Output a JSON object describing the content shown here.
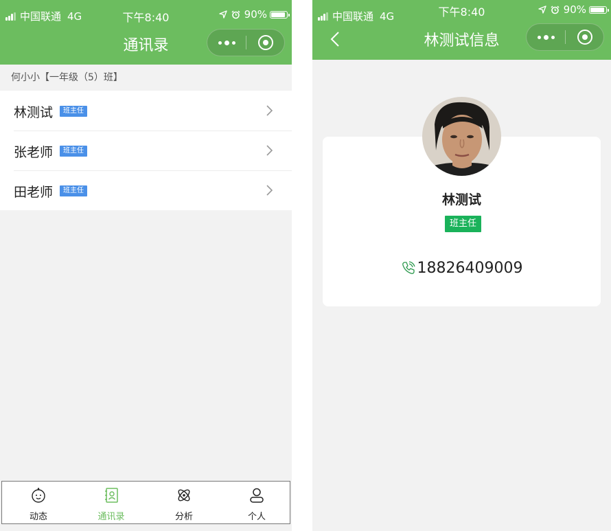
{
  "colors": {
    "header_green": "#6cbd5f",
    "badge_blue": "#4a90e8",
    "badge_green": "#1ab25a",
    "active_tab": "#6cbd5f",
    "background": "#f2f2f2"
  },
  "left_screen": {
    "status_bar": {
      "carrier": "中国联通",
      "network": "4G",
      "time": "下午8:40",
      "battery": "90%",
      "battery_level": 0.9,
      "icons": [
        "signal-icon",
        "location-icon",
        "alarm-icon",
        "battery-icon"
      ]
    },
    "nav": {
      "title": "通讯录",
      "icons": [
        "more-dots-icon",
        "close-circle-icon"
      ]
    },
    "class_label": "何小小【一年级（5）班】",
    "contacts": [
      {
        "name": "林测试",
        "role": "班主任",
        "icon": "chevron-right-icon"
      },
      {
        "name": "张老师",
        "role": "班主任",
        "icon": "chevron-right-icon"
      },
      {
        "name": "田老师",
        "role": "班主任",
        "icon": "chevron-right-icon"
      }
    ],
    "tabbar": {
      "tabs": [
        {
          "label": "动态",
          "icon": "baby-face-icon",
          "active": false
        },
        {
          "label": "通讯录",
          "icon": "contacts-book-icon",
          "active": true
        },
        {
          "label": "分析",
          "icon": "atom-icon",
          "active": false
        },
        {
          "label": "个人",
          "icon": "person-icon",
          "active": false
        }
      ]
    }
  },
  "right_screen": {
    "status_bar": {
      "carrier": "中国联通",
      "network": "4G",
      "time": "下午8:40",
      "battery": "90%",
      "battery_level": 0.9,
      "icons": [
        "signal-icon",
        "location-icon",
        "alarm-icon",
        "battery-icon"
      ]
    },
    "nav": {
      "title": "林测试信息",
      "icons": [
        "back-arrow-icon",
        "more-dots-icon",
        "close-circle-icon"
      ]
    },
    "profile": {
      "avatar": "avatar-photo",
      "name": "林测试",
      "role": "班主任",
      "phone": "18826409009",
      "phone_icon": "phone-icon"
    }
  }
}
